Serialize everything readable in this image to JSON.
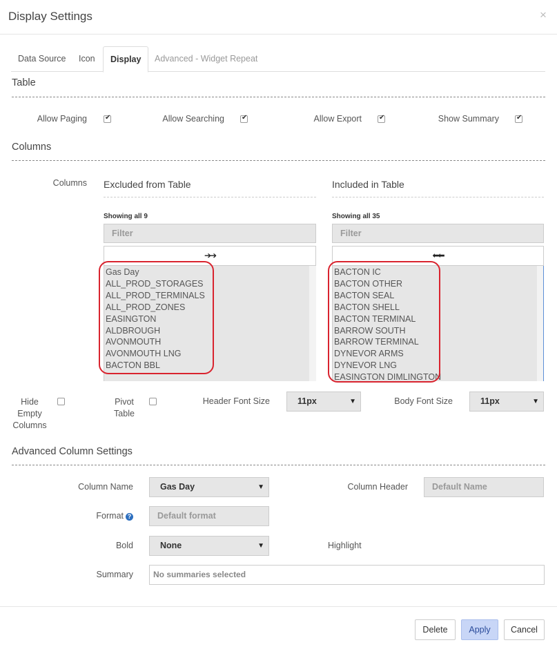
{
  "dialog": {
    "title": "Display Settings",
    "close_glyph": "×"
  },
  "tabs": [
    {
      "label": "Data Source",
      "state": "normal"
    },
    {
      "label": "Icon",
      "state": "normal"
    },
    {
      "label": "Display",
      "state": "active"
    },
    {
      "label": "Advanced - Widget Repeat",
      "state": "disabled"
    }
  ],
  "table_section": {
    "title": "Table",
    "options": [
      {
        "label": "Allow Paging",
        "checked": true
      },
      {
        "label": "Allow Searching",
        "checked": true
      },
      {
        "label": "Allow Export",
        "checked": true
      },
      {
        "label": "Show Summary",
        "checked": true
      }
    ]
  },
  "columns_section": {
    "title": "Columns",
    "row_label": "Columns",
    "excluded": {
      "heading": "Excluded from Table",
      "count_text": "Showing all 9",
      "filter_placeholder": "Filter",
      "move_glyph": "➔➔",
      "items": [
        "Gas Day",
        "ALL_PROD_STORAGES",
        "ALL_PROD_TERMINALS",
        "ALL_PROD_ZONES",
        "EASINGTON",
        "ALDBROUGH",
        "AVONMOUTH",
        "AVONMOUTH LNG",
        "BACTON BBL"
      ]
    },
    "included": {
      "heading": "Included in Table",
      "count_text": "Showing all 35",
      "filter_placeholder": "Filter",
      "move_glyph": "⬅⬅",
      "items": [
        "BACTON IC",
        "BACTON OTHER",
        "BACTON SEAL",
        "BACTON SHELL",
        "BACTON TERMINAL",
        "BARROW SOUTH",
        "BARROW TERMINAL",
        "DYNEVOR ARMS",
        "DYNEVOR LNG",
        "EASINGTON DIMLINGTON"
      ]
    }
  },
  "display_options": {
    "hide_empty_columns": {
      "label_line1": "Hide",
      "label_line2": "Empty",
      "label_line3": "Columns",
      "checked": false
    },
    "pivot_table": {
      "label_line1": "Pivot",
      "label_line2": "Table",
      "checked": false
    },
    "header_font_size": {
      "label": "Header Font Size",
      "value": "11px"
    },
    "body_font_size": {
      "label": "Body Font Size",
      "value": "11px"
    }
  },
  "advanced_section": {
    "title": "Advanced Column Settings",
    "column_name": {
      "label": "Column Name",
      "value": "Gas Day"
    },
    "column_header": {
      "label": "Column Header",
      "placeholder": "Default Name"
    },
    "format": {
      "label": "Format",
      "placeholder": "Default format",
      "help_glyph": "?"
    },
    "bold": {
      "label": "Bold",
      "value": "None"
    },
    "highlight": {
      "label": "Highlight"
    },
    "summary": {
      "label": "Summary",
      "value": "No summaries selected"
    }
  },
  "footer": {
    "delete_label": "Delete",
    "apply_label": "Apply",
    "cancel_label": "Cancel"
  },
  "colors": {
    "highlight_border": "#d9232e",
    "apply_bg": "#c8d6f7",
    "list_bg": "#e6e6e6"
  },
  "icons": {
    "dropdown": "chevron-down-icon",
    "checkbox": "checkbox-icon",
    "help": "help-circle-icon"
  }
}
